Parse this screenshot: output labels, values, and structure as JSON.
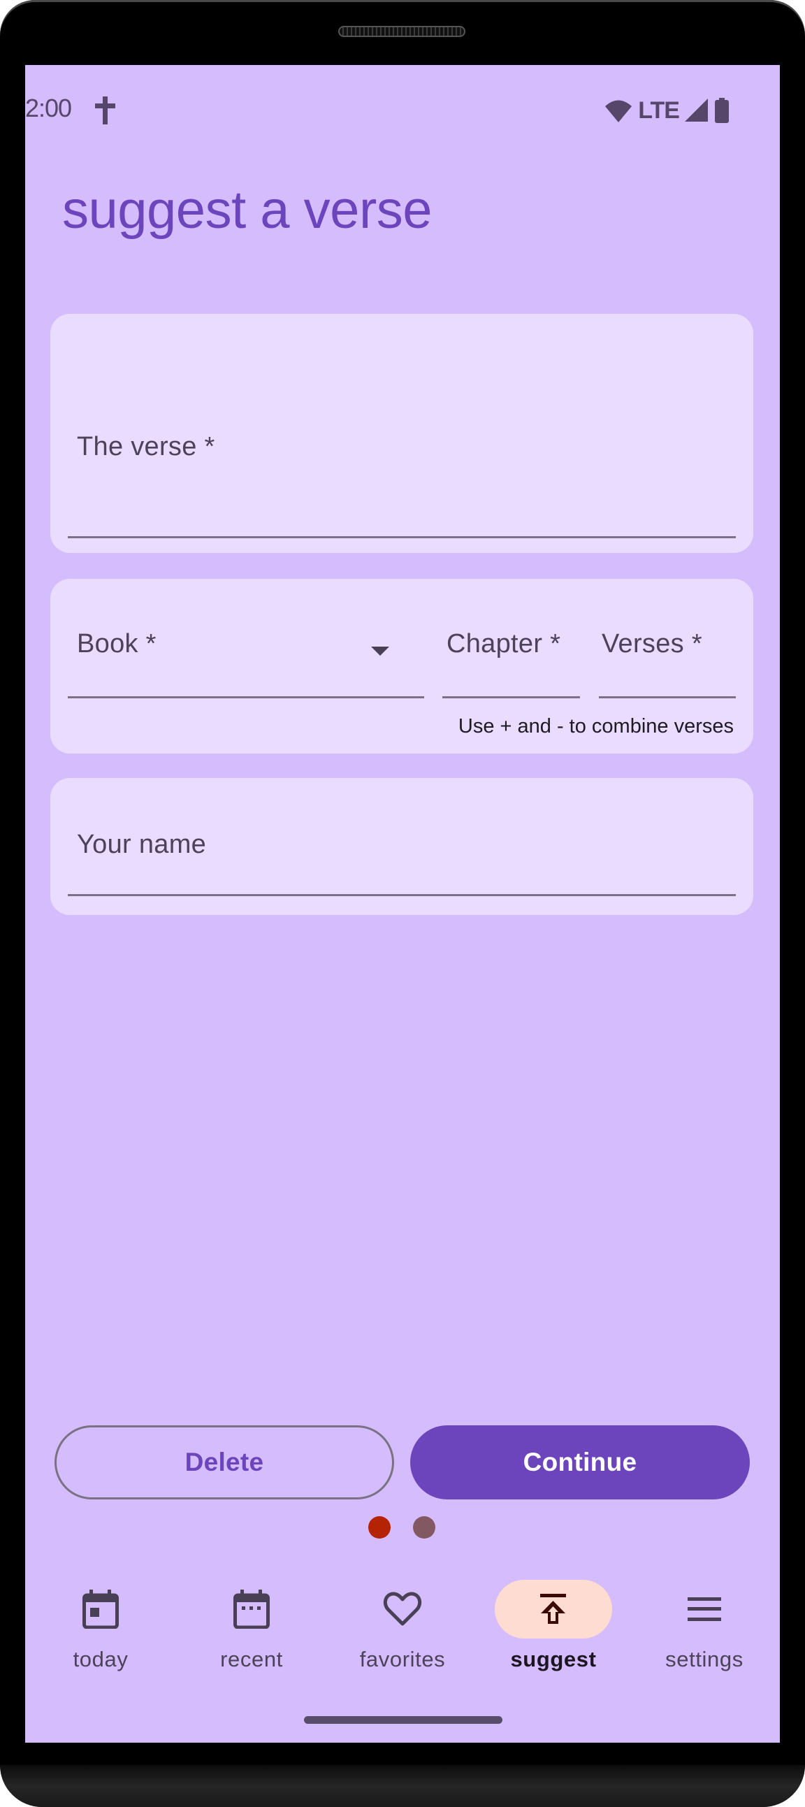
{
  "status_bar": {
    "time": "2:00",
    "network": "LTE",
    "icons": [
      "cross-icon",
      "wifi-icon",
      "signal-icon",
      "battery-icon"
    ]
  },
  "page": {
    "title": "suggest a verse"
  },
  "form": {
    "verse_field": {
      "label": "The verse *",
      "value": ""
    },
    "book_field": {
      "label": "Book *",
      "value": "",
      "icon": "dropdown-arrow-icon"
    },
    "chapter_field": {
      "label": "Chapter *",
      "value": ""
    },
    "verses_field": {
      "label": "Verses *",
      "value": ""
    },
    "verses_helper": "Use + and - to combine verses",
    "name_field": {
      "label": "Your name",
      "value": ""
    }
  },
  "actions": {
    "delete_label": "Delete",
    "continue_label": "Continue"
  },
  "pager": {
    "current_page": 1,
    "total_pages": 2,
    "active_color": "#b52305",
    "inactive_color": "#825963"
  },
  "nav": {
    "items": [
      {
        "label": "today",
        "icon": "calendar-today-icon",
        "active": false
      },
      {
        "label": "recent",
        "icon": "calendar-recent-icon",
        "active": false
      },
      {
        "label": "favorites",
        "icon": "heart-icon",
        "active": false
      },
      {
        "label": "suggest",
        "icon": "upload-icon",
        "active": true
      },
      {
        "label": "settings",
        "icon": "menu-icon",
        "active": false
      }
    ]
  },
  "theme": {
    "background": "#d5bcfd",
    "surface": "#eadcfe",
    "primary": "#6c45bd",
    "active_indicator": "#ffdcd2"
  }
}
